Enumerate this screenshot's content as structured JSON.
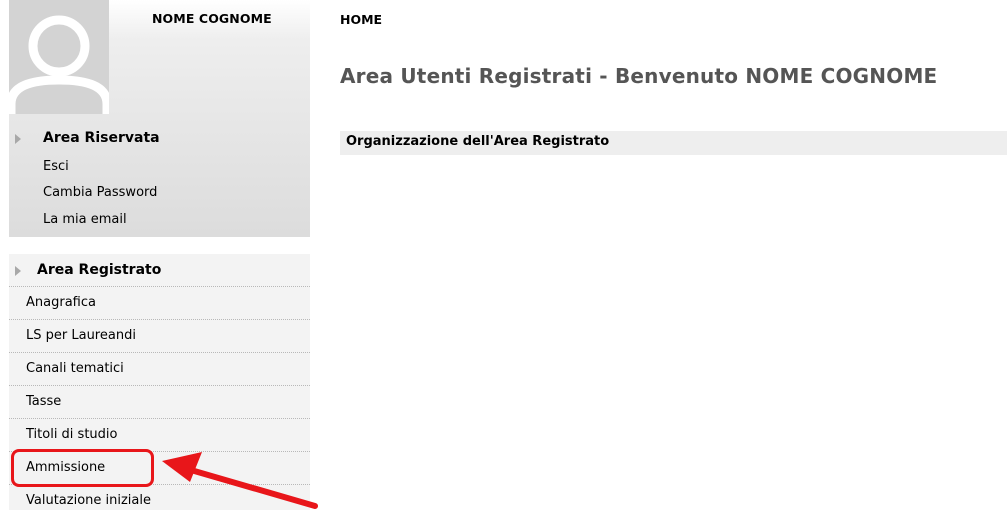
{
  "user": {
    "name": "NOME COGNOME"
  },
  "reserved_area": {
    "title": "Area Riservata",
    "links": [
      "Esci",
      "Cambia Password",
      "La mia email"
    ]
  },
  "registered_area": {
    "title": "Area Registrato",
    "items": [
      "Anagrafica",
      "LS per Laureandi",
      "Canali tematici",
      "Tasse",
      "Titoli di studio",
      "Ammissione",
      "Valutazione iniziale"
    ]
  },
  "main": {
    "breadcrumb": "HOME",
    "welcome": "Area Utenti Registrati - Benvenuto NOME COGNOME",
    "section_title": "Organizzazione dell'Area Registrato"
  },
  "annotation": {
    "highlighted_item": "Ammissione",
    "color": "#e8161a"
  },
  "colors": {
    "sidebar_bg": "#dcdcdc",
    "menu_bg": "#f3f3f3",
    "heading_gray": "#555555"
  }
}
